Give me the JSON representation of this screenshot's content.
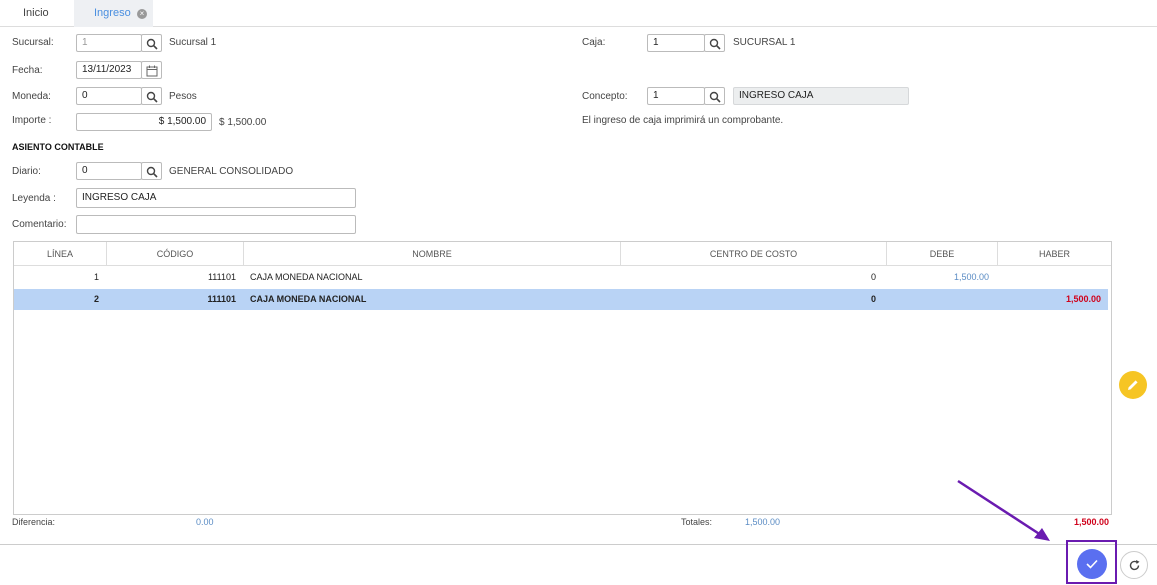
{
  "tabs": [
    {
      "label": "Inicio"
    },
    {
      "label": "Ingreso"
    }
  ],
  "form": {
    "sucursal": {
      "label": "Sucursal:",
      "value": "1",
      "desc": "Sucursal 1"
    },
    "caja": {
      "label": "Caja:",
      "value": "1",
      "desc": "SUCURSAL 1"
    },
    "fecha": {
      "label": "Fecha:",
      "value": "13/11/2023"
    },
    "moneda": {
      "label": "Moneda:",
      "value": "0",
      "desc": "Pesos"
    },
    "concepto": {
      "label": "Concepto:",
      "value": "1",
      "desc": "INGRESO CAJA"
    },
    "importe": {
      "label": "Importe :",
      "value": "$ 1,500.00",
      "desc": "$ 1,500.00"
    },
    "info_msg": "El ingreso de caja imprimirá un comprobante.",
    "section_title": "ASIENTO CONTABLE",
    "diario": {
      "label": "Diario:",
      "value": "0",
      "desc": "GENERAL CONSOLIDADO"
    },
    "leyenda": {
      "label": "Leyenda :",
      "value": "INGRESO CAJA"
    },
    "comentario": {
      "label": "Comentario:",
      "value": ""
    }
  },
  "table": {
    "headers": [
      "LÍNEA",
      "CÓDIGO",
      "NOMBRE",
      "CENTRO DE COSTO",
      "DEBE",
      "HABER"
    ],
    "rows": [
      {
        "linea": "1",
        "codigo": "111101",
        "nombre": "CAJA MONEDA NACIONAL",
        "centro": "0",
        "debe": "1,500.00",
        "haber": ""
      },
      {
        "linea": "2",
        "codigo": "111101",
        "nombre": "CAJA MONEDA NACIONAL",
        "centro": "0",
        "debe": "",
        "haber": "1,500.00",
        "selected": true
      }
    ]
  },
  "footer": {
    "diferencia_label": "Diferencia:",
    "diferencia_value": "0.00",
    "totales_label": "Totales:",
    "total_debe": "1,500.00",
    "total_haber": "1,500.00"
  },
  "actions": {
    "edit_icon": "pencil-icon",
    "confirm_icon": "check-icon",
    "refresh_icon": "refresh-icon"
  },
  "colors": {
    "accent": "#4a8fe0",
    "selected_row": "#b9d3f5",
    "haber": "#d0021b",
    "debe": "#5b8cc4",
    "edit_fab": "#f6c524",
    "confirm_fab": "#5a6ff0",
    "highlight": "#6a1bb0"
  }
}
